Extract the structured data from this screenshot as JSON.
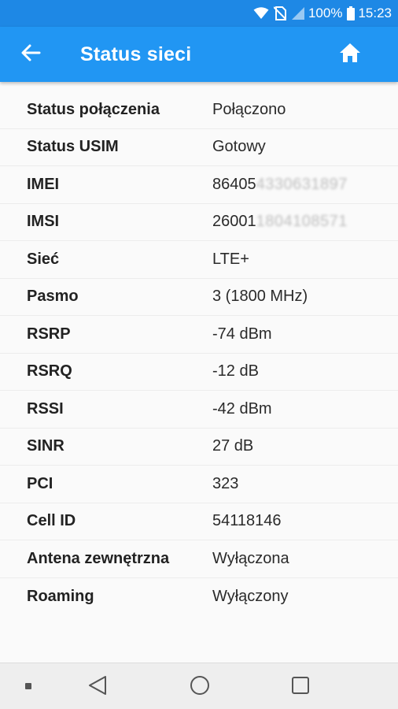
{
  "status_bar": {
    "battery_percent": "100%",
    "time": "15:23",
    "icons": [
      "wifi-icon",
      "no-sim-icon",
      "signal-icon",
      "battery-icon"
    ]
  },
  "app_bar": {
    "title": "Status sieci",
    "back_icon": "arrow-back-icon",
    "home_icon": "home-icon"
  },
  "rows": [
    {
      "label": "Status połączenia",
      "value": "Połączono"
    },
    {
      "label": "Status USIM",
      "value": "Gotowy"
    },
    {
      "label": "IMEI",
      "value": "86405",
      "value_hidden": "4330631897"
    },
    {
      "label": "IMSI",
      "value": "26001",
      "value_hidden": "1804108571"
    },
    {
      "label": "Sieć",
      "value": "LTE+"
    },
    {
      "label": "Pasmo",
      "value": "3 (1800 MHz)"
    },
    {
      "label": "RSRP",
      "value": "-74 dBm"
    },
    {
      "label": "RSRQ",
      "value": "-12 dB"
    },
    {
      "label": "RSSI",
      "value": "-42 dBm"
    },
    {
      "label": "SINR",
      "value": "27 dB"
    },
    {
      "label": "PCI",
      "value": "323"
    },
    {
      "label": "Cell ID",
      "value": "54118146"
    },
    {
      "label": "Antena zewnętrzna",
      "value": "Wyłączona"
    },
    {
      "label": "Roaming",
      "value": "Wyłączony"
    }
  ],
  "nav_bar": {
    "icons": [
      "dot-icon",
      "back-triangle-icon",
      "home-circle-icon",
      "recents-square-icon"
    ]
  },
  "colors": {
    "app_bar": "#2196f3",
    "status_bar": "#1e88e5"
  }
}
